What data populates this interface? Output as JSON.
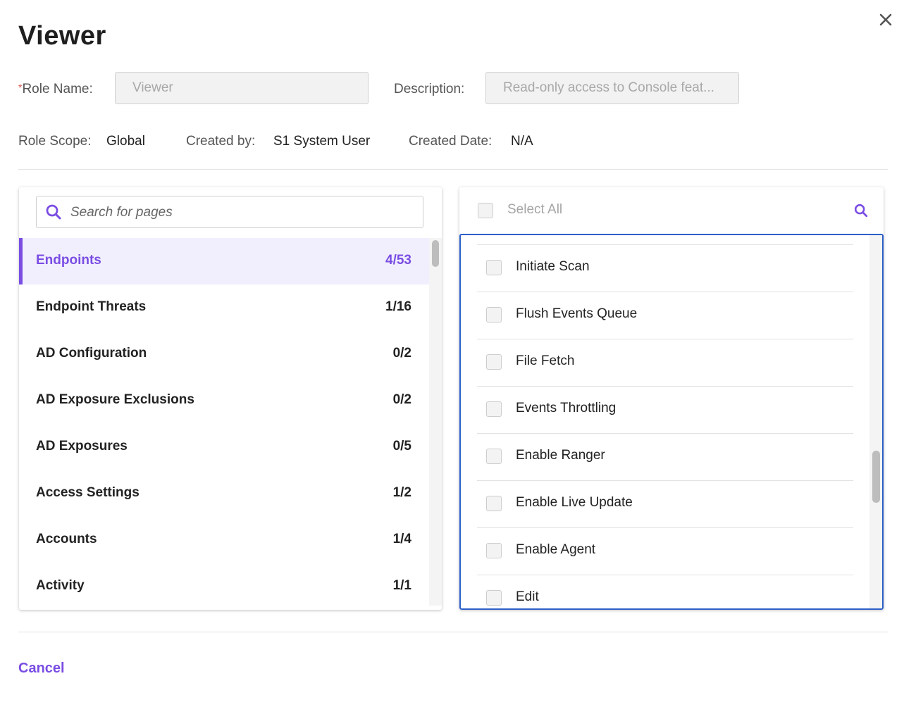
{
  "dialog": {
    "title": "Viewer",
    "close_icon": "close-icon"
  },
  "form": {
    "role_name_required_mark": "*",
    "role_name_label": "Role Name:",
    "role_name_value": "Viewer",
    "description_label": "Description:",
    "description_value": "Read-only access to Console feat..."
  },
  "meta": {
    "role_scope_label": "Role Scope:",
    "role_scope_value": "Global",
    "created_by_label": "Created by:",
    "created_by_value": "S1 System User",
    "created_date_label": "Created Date:",
    "created_date_value": "N/A"
  },
  "categories": {
    "search_placeholder": "Search for pages",
    "items": [
      {
        "name": "Endpoints",
        "count": "4/53",
        "active": true
      },
      {
        "name": "Endpoint Threats",
        "count": "1/16"
      },
      {
        "name": "AD Configuration",
        "count": "0/2"
      },
      {
        "name": "AD Exposure Exclusions",
        "count": "0/2"
      },
      {
        "name": "AD Exposures",
        "count": "0/5"
      },
      {
        "name": "Access Settings",
        "count": "1/2"
      },
      {
        "name": "Accounts",
        "count": "1/4"
      },
      {
        "name": "Activity",
        "count": "1/1"
      }
    ]
  },
  "permissions": {
    "select_all_label": "Select All",
    "items": [
      {
        "label": "Initiate Scan",
        "checked": false
      },
      {
        "label": "Flush Events Queue",
        "checked": false
      },
      {
        "label": "File Fetch",
        "checked": false
      },
      {
        "label": "Events Throttling",
        "checked": false
      },
      {
        "label": "Enable Ranger",
        "checked": false
      },
      {
        "label": "Enable Live Update",
        "checked": false
      },
      {
        "label": "Enable Agent",
        "checked": false
      },
      {
        "label": "Edit",
        "checked": false
      }
    ]
  },
  "footer": {
    "cancel_label": "Cancel"
  },
  "colors": {
    "accent": "#7a4de3",
    "active_row_bg": "#f1effd",
    "focus_border": "#2c5fc7",
    "required": "#d9534f"
  }
}
